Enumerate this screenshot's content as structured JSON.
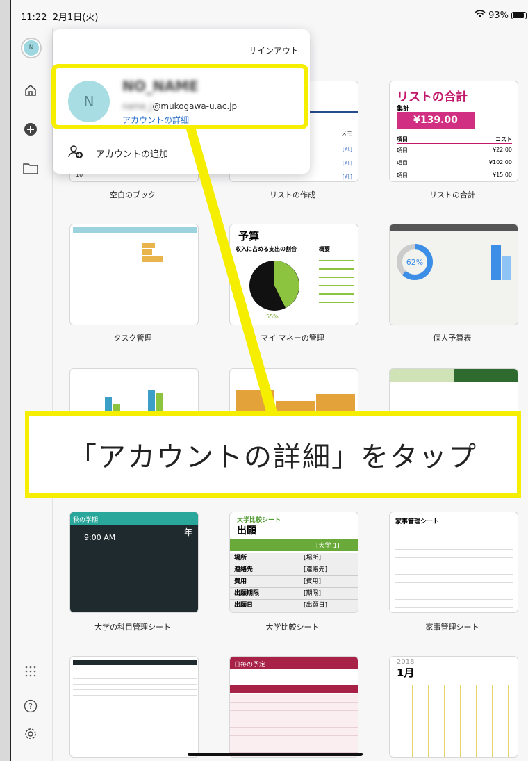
{
  "status": {
    "time": "11:22",
    "date": "2月1日(火)",
    "battery": "93%"
  },
  "popover": {
    "signout": "サインアウト",
    "account_name": "NO_NAME",
    "account_email_hidden": "name_j",
    "account_email_domain": "@mukogawa-u.ac.jp",
    "account_details": "アカウントの詳細",
    "add_account": "アカウントの追加",
    "avatar_initial": "N"
  },
  "callout": {
    "text": "「アカウントの詳細」をタップ"
  },
  "tiles": [
    {
      "label": "空白のブック"
    },
    {
      "label": "リストの作成"
    },
    {
      "label": "リストの合計"
    },
    {
      "label": "タスク管理"
    },
    {
      "label": "マイ マネーの管理"
    },
    {
      "label": "個人予算表"
    },
    {
      "label": "大学の科目管理シート"
    },
    {
      "label": "大学比較シート"
    },
    {
      "label": "家事管理シート"
    }
  ],
  "thumb": {
    "list_total_title": "リストの合計",
    "list_total_sub": "集計",
    "list_total_amount": "¥139.00",
    "list_total_col1": "項目",
    "list_total_col2": "コスト",
    "list_total_rows": [
      [
        "項目",
        "¥22.00"
      ],
      [
        "項目",
        "¥102.00"
      ],
      [
        "項目",
        "¥15.00"
      ]
    ],
    "memo": "メモ",
    "memo_cell": "[ﾒﾓ]",
    "budget_title": "予算",
    "budget_sub": "収入に占める支出の割合",
    "budget_summary": "概要",
    "budget_pct": "55%",
    "personal_pct": "62%",
    "compare_title": "大学比較シート",
    "compare_sub": "出願",
    "compare_col": "[大学 1]",
    "compare_rows": [
      [
        "場所",
        "[場所]"
      ],
      [
        "連絡先",
        "[連絡先]"
      ],
      [
        "費用",
        "[費用]"
      ],
      [
        "出願期限",
        "[期限]"
      ],
      [
        "出願日",
        "[出願日]"
      ]
    ],
    "schedule_title": "日毎の予定",
    "calendar_year": "2018",
    "calendar_month": "1月",
    "subject_title": "秋の学期",
    "subject_time": "9:00 AM",
    "subject_year": "年",
    "chores_title": "家事管理シート",
    "blank_cell": "10"
  }
}
